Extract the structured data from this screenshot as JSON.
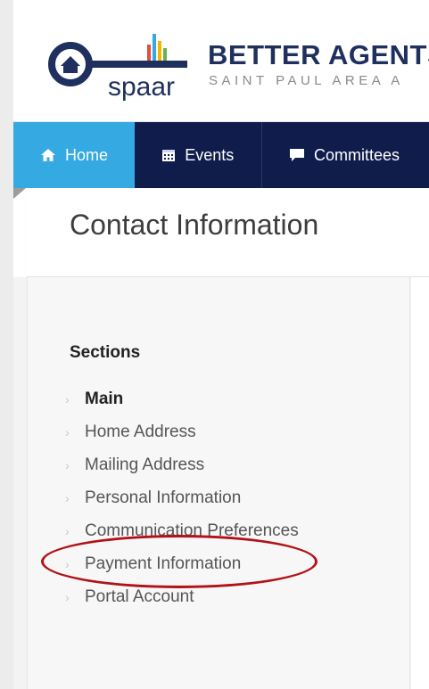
{
  "header": {
    "logo_text": "spaar",
    "brand_title": "BETTER AGENTS",
    "brand_subtitle": "SAINT PAUL AREA A"
  },
  "nav": {
    "items": [
      {
        "label": "Home",
        "icon": "home-icon",
        "active": true
      },
      {
        "label": "Events",
        "icon": "calendar-icon",
        "active": false
      },
      {
        "label": "Committees",
        "icon": "comment-icon",
        "active": false
      }
    ]
  },
  "page": {
    "title": "Contact Information"
  },
  "sidebar": {
    "heading": "Sections",
    "items": [
      {
        "label": "Main",
        "active": true
      },
      {
        "label": "Home Address",
        "active": false
      },
      {
        "label": "Mailing Address",
        "active": false
      },
      {
        "label": "Personal Information",
        "active": false
      },
      {
        "label": "Communication Preferences",
        "active": false
      },
      {
        "label": "Payment Information",
        "active": false,
        "highlighted": true
      },
      {
        "label": "Portal Account",
        "active": false
      }
    ]
  },
  "colors": {
    "nav_bg": "#101d4c",
    "nav_active": "#35a9e1",
    "brand_navy": "#1f2f5e",
    "highlight_red": "#b11217"
  }
}
